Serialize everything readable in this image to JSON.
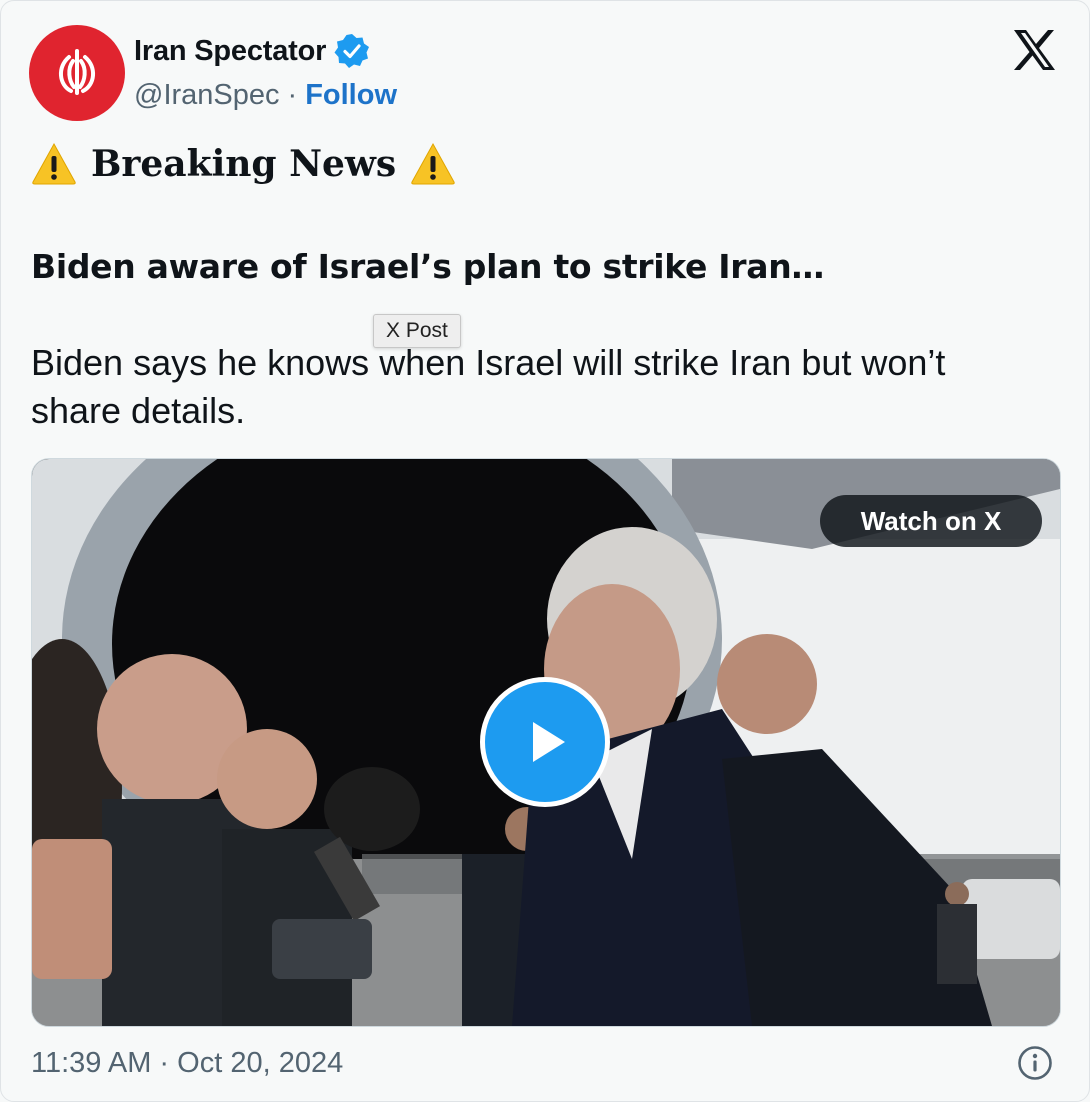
{
  "author": {
    "display_name": "Iran Spectator",
    "handle": "@IranSpec",
    "separator": "·",
    "follow_label": "Follow",
    "verified": true
  },
  "post": {
    "breaking_label": "Breaking News",
    "headline": "Biden aware of Israel’s plan to strike Iran…",
    "body": "Biden says he knows when Israel will strike Iran but won’t share details.",
    "tooltip": "X Post"
  },
  "media": {
    "watch_label": "Watch on X"
  },
  "footer": {
    "timestamp": "11:39 AM · Oct 20, 2024"
  },
  "colors": {
    "brand_blue": "#1d9bf0",
    "follow_blue": "#1d73c9",
    "avatar_red": "#e0242f",
    "muted_text": "#536471"
  },
  "icons": {
    "verified": "verified-badge-icon",
    "logo": "x-logo-icon",
    "warning": "warning-icon",
    "play": "play-icon",
    "info": "info-icon"
  }
}
